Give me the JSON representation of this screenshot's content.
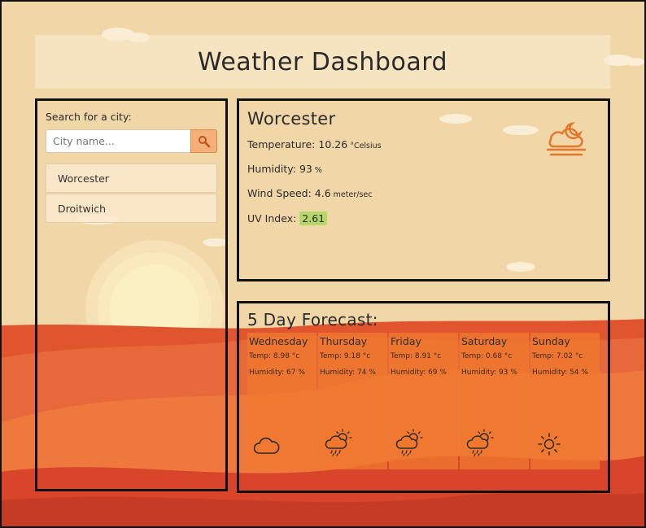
{
  "header": {
    "title": "Weather Dashboard"
  },
  "search": {
    "label": "Search for a city:",
    "placeholder": "City name...",
    "button_icon": "search-icon"
  },
  "history": [
    {
      "label": "Worcester"
    },
    {
      "label": "Droitwich"
    }
  ],
  "current": {
    "city": "Worcester",
    "temperature_label": "Temperature:",
    "temperature": "10.26",
    "temperature_unit": "°Celsius",
    "humidity_label": "Humidity:",
    "humidity": "93",
    "humidity_unit": "%",
    "wind_label": "Wind Speed:",
    "wind": "4.6",
    "wind_unit": "meter/sec",
    "uv_label": "UV Index:",
    "uv": "2.61",
    "icon": "partly-cloudy-night-fog-icon"
  },
  "forecast": {
    "title": "5 Day Forecast:",
    "days": [
      {
        "day": "Wednesday",
        "temp": "Temp: 8.98 °c",
        "humidity": "Humidity: 67 %",
        "icon": "cloud-icon"
      },
      {
        "day": "Thursday",
        "temp": "Temp: 9.18 °c",
        "humidity": "Humidity: 74 %",
        "icon": "sun-rain-icon"
      },
      {
        "day": "Friday",
        "temp": "Temp: 8.91 °c",
        "humidity": "Humidity: 69 %",
        "icon": "sun-rain-icon"
      },
      {
        "day": "Saturday",
        "temp": "Temp: 0.68 °c",
        "humidity": "Humidity: 93 %",
        "icon": "sun-rain-icon"
      },
      {
        "day": "Sunday",
        "temp": "Temp: 7.02 °c",
        "humidity": "Humidity: 54 %",
        "icon": "sun-icon"
      }
    ]
  },
  "colors": {
    "accent": "#f5b07a",
    "uv_badge": "#b7d66b",
    "card": "#ef782e"
  }
}
